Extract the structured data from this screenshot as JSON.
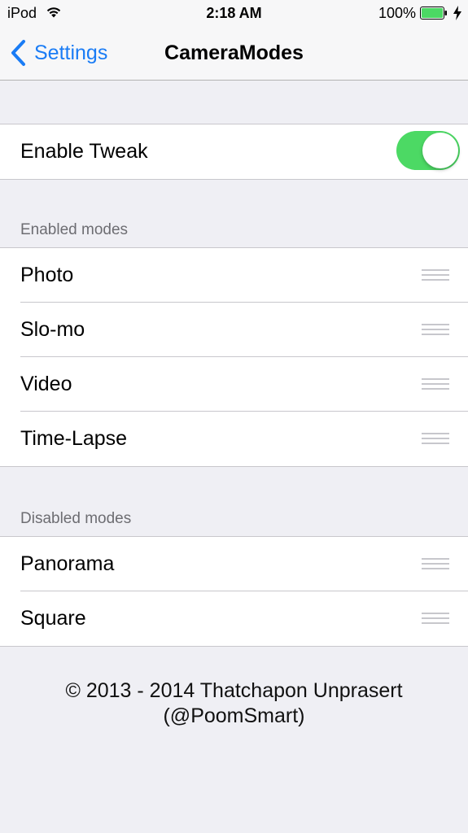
{
  "status_bar": {
    "carrier": "iPod",
    "time": "2:18 AM",
    "battery": "100%"
  },
  "nav": {
    "back_label": "Settings",
    "title": "CameraModes"
  },
  "toggle_group": {
    "label": "Enable Tweak",
    "enabled": true
  },
  "enabled_section": {
    "header": "Enabled modes",
    "items": [
      {
        "label": "Photo"
      },
      {
        "label": "Slo-mo"
      },
      {
        "label": "Video"
      },
      {
        "label": "Time-Lapse"
      }
    ]
  },
  "disabled_section": {
    "header": "Disabled modes",
    "items": [
      {
        "label": "Panorama"
      },
      {
        "label": "Square"
      }
    ]
  },
  "footer": {
    "line1": "© 2013 - 2014 Thatchapon Unprasert",
    "line2": "(@PoomSmart)"
  },
  "colors": {
    "accent": "#1a7cf5",
    "toggle_on": "#4cd964",
    "background": "#efeff4"
  }
}
